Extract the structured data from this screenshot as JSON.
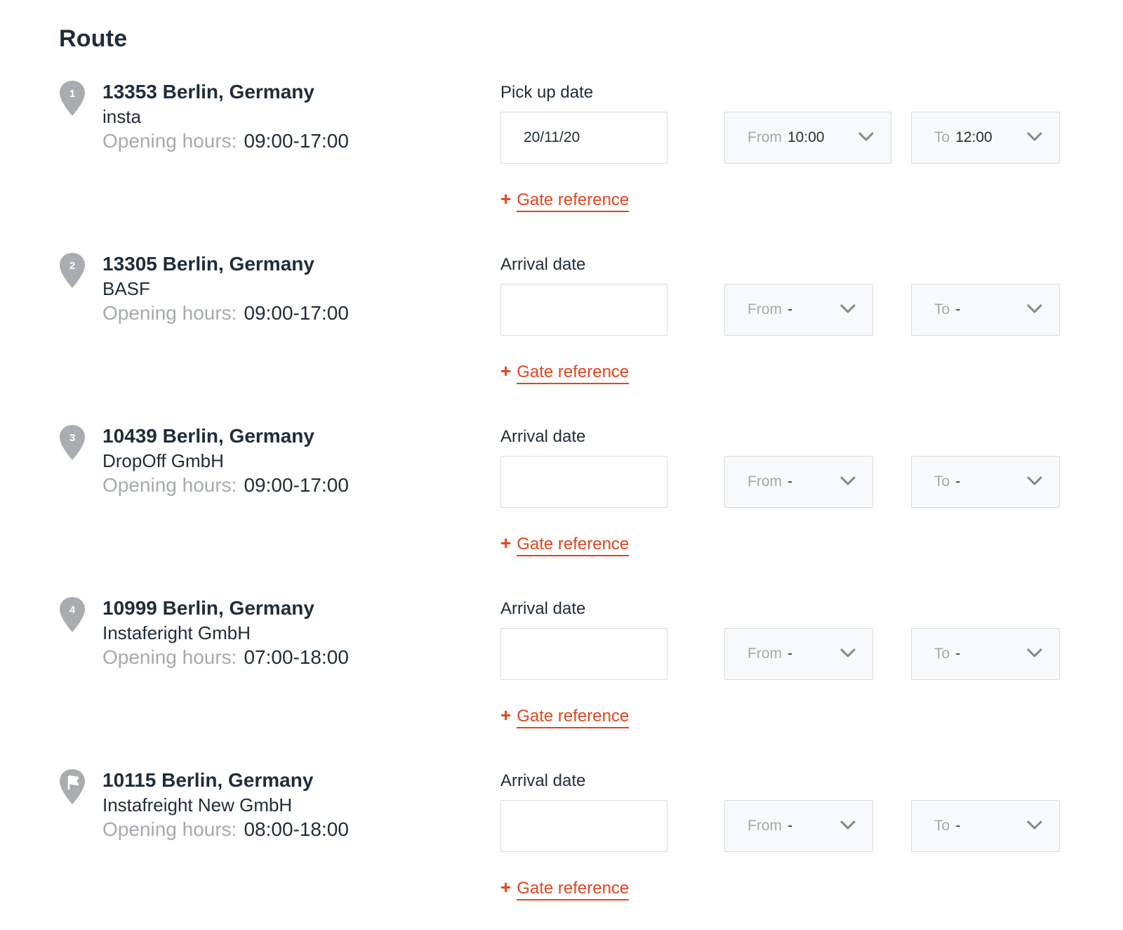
{
  "title": "Route",
  "colors": {
    "accent": "#e0451f",
    "text": "#1f2d3a",
    "muted": "#a5aab0",
    "pin": "#a9adb1",
    "border": "#d9dde1",
    "select_bg": "#f8f9fa"
  },
  "opening_hours_label": "Opening hours:",
  "gate_reference_label": "Gate reference",
  "gate_reference_icon": "plus-icon",
  "from_label": "From",
  "to_label": "To",
  "stops": [
    {
      "marker": "1",
      "marker_icon": "location-pin-icon",
      "address": "13353 Berlin, Germany",
      "company": "insta",
      "hours": "09:00-17:00",
      "date_label": "Pick up date",
      "date_value": "20/11/20",
      "from_value": "10:00",
      "to_value": "12:00"
    },
    {
      "marker": "2",
      "marker_icon": "location-pin-icon",
      "address": "13305 Berlin, Germany",
      "company": "BASF",
      "hours": "09:00-17:00",
      "date_label": "Arrival date",
      "date_value": "",
      "from_value": "-",
      "to_value": "-"
    },
    {
      "marker": "3",
      "marker_icon": "location-pin-icon",
      "address": "10439 Berlin, Germany",
      "company": "DropOff GmbH",
      "hours": "09:00-17:00",
      "date_label": "Arrival date",
      "date_value": "",
      "from_value": "-",
      "to_value": "-"
    },
    {
      "marker": "4",
      "marker_icon": "location-pin-icon",
      "address": "10999 Berlin, Germany",
      "company": "Instaferight GmbH",
      "hours": "07:00-18:00",
      "date_label": "Arrival date",
      "date_value": "",
      "from_value": "-",
      "to_value": "-"
    },
    {
      "marker": "",
      "marker_icon": "flag-pin-icon",
      "address": "10115 Berlin, Germany",
      "company": "Instafreight New GmbH",
      "hours": "08:00-18:00",
      "date_label": "Arrival date",
      "date_value": "",
      "from_value": "-",
      "to_value": "-"
    }
  ]
}
